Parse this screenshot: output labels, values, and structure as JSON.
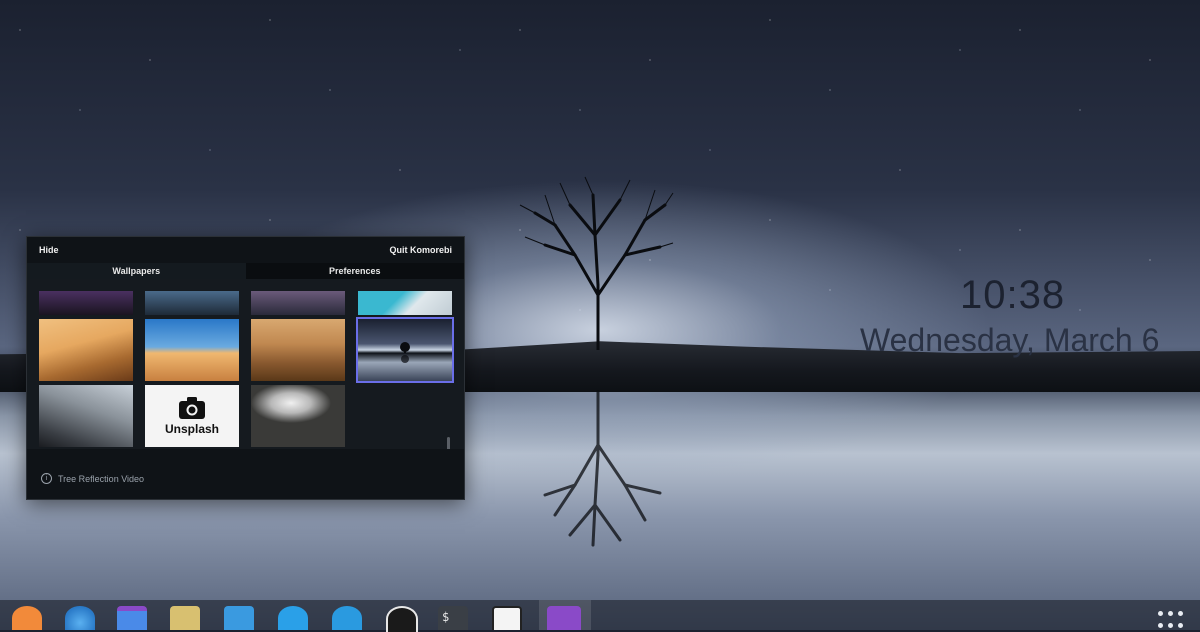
{
  "desktop": {
    "clock_time": "10:38",
    "clock_date": "Wednesday, March 6"
  },
  "panel": {
    "hide_label": "Hide",
    "quit_label": "Quit Komorebi",
    "tabs": [
      {
        "label": "Wallpapers",
        "active": true
      },
      {
        "label": "Preferences",
        "active": false
      }
    ],
    "unsplash_label": "Unsplash",
    "current_wallpaper": "Tree Reflection Video",
    "accent_color": "#6a6ee8"
  },
  "thumbnails": [
    {
      "name": "mountain-dusk",
      "colors": [
        "#3a2a4a",
        "#1a1420"
      ]
    },
    {
      "name": "mountain-blue",
      "colors": [
        "#4a6a8a",
        "#1e2a38"
      ]
    },
    {
      "name": "night-sky",
      "colors": [
        "#6a5a7a",
        "#2a2a3a"
      ]
    },
    {
      "name": "beach-aerial",
      "colors": [
        "#3ab8d0",
        "#e0e8ec"
      ]
    },
    {
      "name": "desert-dunes-1",
      "colors": [
        "#e6a860",
        "#8a5220"
      ]
    },
    {
      "name": "desert-dunes-2",
      "colors": [
        "#2a78c8",
        "#e2a560"
      ]
    },
    {
      "name": "desert-dunes-3",
      "colors": [
        "#c08850",
        "#6a4220"
      ]
    },
    {
      "name": "tree-reflection",
      "colors": [
        "#1a2030",
        "#c8d4e4"
      ],
      "selected": true
    },
    {
      "name": "tunnel",
      "colors": [
        "#b0b8c0",
        "#2a2e32"
      ]
    },
    {
      "name": "unsplash"
    },
    {
      "name": "foggy-forest",
      "colors": [
        "#e0e0e0",
        "#2a2a28"
      ]
    }
  ],
  "dock": [
    {
      "name": "fox-app-icon",
      "color": "#f28a3a"
    },
    {
      "name": "browser-icon",
      "color": "#2a7ac8"
    },
    {
      "name": "files-icon",
      "color": "#4a8ae8"
    },
    {
      "name": "cassette-app-icon",
      "color": "#d8c070"
    },
    {
      "name": "software-center-icon",
      "color": "#3a9ae0"
    },
    {
      "name": "settings-sliders-icon",
      "color": "#2aa0e8"
    },
    {
      "name": "telegram-icon",
      "color": "#2a9ae0"
    },
    {
      "name": "clock-app-icon",
      "color": "#1a1a1a"
    },
    {
      "name": "terminal-icon",
      "color": "#3a3f46"
    },
    {
      "name": "play-store-icon",
      "color": "#f4f4f4"
    },
    {
      "name": "komorebi-icon",
      "color": "#8a4ac8"
    }
  ]
}
